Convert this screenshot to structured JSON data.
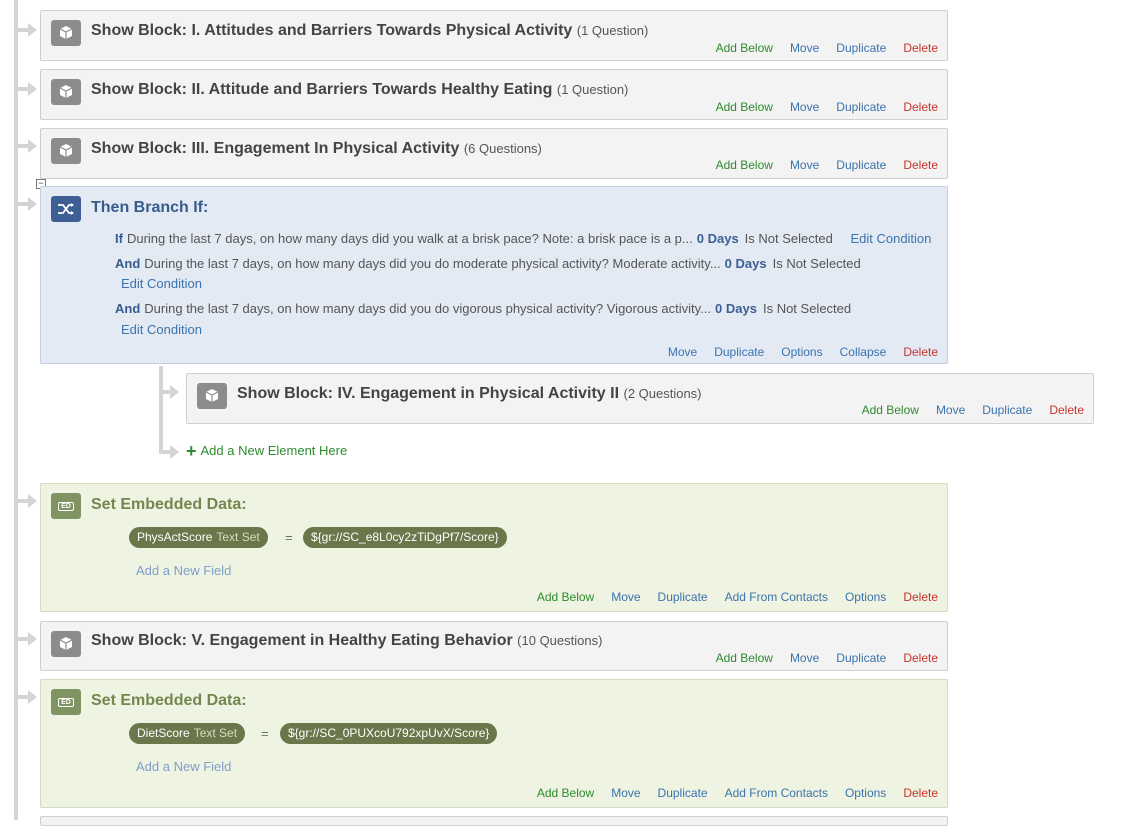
{
  "blocks": [
    {
      "label": "Show Block: I. Attitudes and Barriers Towards Physical Activity",
      "count": "(1 Question)"
    },
    {
      "label": "Show Block: II. Attitude and Barriers Towards Healthy Eating",
      "count": "(1 Question)"
    },
    {
      "label": "Show Block: III. Engagement In Physical Activity",
      "count": "(6 Questions)"
    },
    {
      "label": "Show Block: IV. Engagement in Physical Activity II",
      "count": "(2 Questions)"
    },
    {
      "label": "Show Block: V. Engagement in Healthy Eating Behavior",
      "count": "(10 Questions)"
    }
  ],
  "block_actions": {
    "add_below": "Add Below",
    "move": "Move",
    "duplicate": "Duplicate",
    "delete": "Delete"
  },
  "branch": {
    "title": "Then Branch If:",
    "conditions": [
      {
        "keyword": "If",
        "question": "During the last 7 days, on how many days did you walk at a brisk pace?  Note: a brisk pace is a p...",
        "value": "0 Days",
        "operator": "Is Not Selected",
        "edit": "Edit Condition"
      },
      {
        "keyword": "And",
        "question": "During the last 7 days, on how many days did you do moderate physical activity? Moderate activity...",
        "value": "0 Days",
        "operator": "Is Not Selected",
        "edit": "Edit Condition"
      },
      {
        "keyword": "And",
        "question": "During the last 7 days, on how many days did you do vigorous physical activity? Vigorous activity...",
        "value": "0 Days",
        "operator": "Is Not Selected",
        "edit": "Edit Condition"
      }
    ],
    "actions": {
      "move": "Move",
      "duplicate": "Duplicate",
      "options": "Options",
      "collapse": "Collapse",
      "delete": "Delete"
    }
  },
  "add_element": "Add a New Element Here",
  "embedded": [
    {
      "title": "Set Embedded Data:",
      "icon_text": "ED",
      "field": "PhysActScore",
      "field_type": "Text Set",
      "equals": "=",
      "value": "${gr://SC_e8L0cy2zTiDgPf7/Score}",
      "add_field": "Add a New Field"
    },
    {
      "title": "Set Embedded Data:",
      "icon_text": "ED",
      "field": "DietScore",
      "field_type": "Text Set",
      "equals": "=",
      "value": "${gr://SC_0PUXcoU792xpUvX/Score}",
      "add_field": "Add a New Field"
    }
  ],
  "embedded_actions": {
    "add_below": "Add Below",
    "move": "Move",
    "duplicate": "Duplicate",
    "add_from_contacts": "Add From Contacts",
    "options": "Options",
    "delete": "Delete"
  },
  "icons": {
    "block": "cube-icon",
    "branch": "shuffle-icon",
    "embedded": "embedded-data-icon",
    "add": "plus-icon"
  },
  "colors": {
    "green_action": "#2e8b2e",
    "blue_action": "#3b73ae",
    "red_action": "#c6342c",
    "branch_bg": "#e3eaf4",
    "embedded_bg": "#eef3e2",
    "block_bg": "#f3f3f3"
  }
}
